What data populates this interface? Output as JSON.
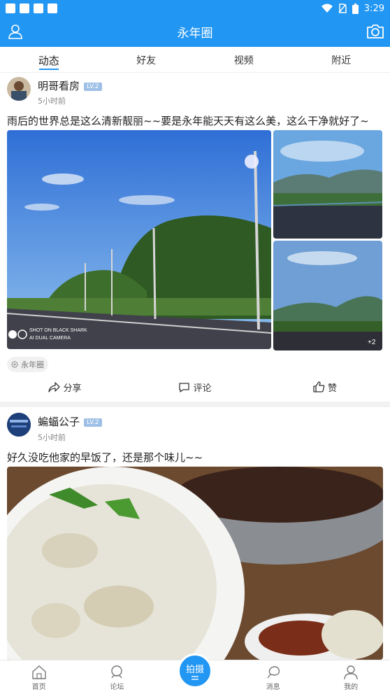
{
  "status_bar": {
    "time": "3:29"
  },
  "app_bar": {
    "title": "永年圈"
  },
  "tabs": [
    "动态",
    "好友",
    "视频",
    "附近"
  ],
  "posts": [
    {
      "author": "明哥看房",
      "level": "LV.2",
      "time": "5小时前",
      "text": "雨后的世界总是这么清新靓丽~~要是永年能天天有这么美，这么干净就好了~",
      "photo_watermark_1": "SHOT ON BLACK SHARK",
      "photo_watermark_2": "AI DUAL CAMERA",
      "more_count": "+2",
      "tag": "永年圈",
      "actions": {
        "share": "分享",
        "comment": "评论",
        "like": "赞"
      }
    },
    {
      "author": "蝙蝠公子",
      "level": "LV.2",
      "time": "5小时前",
      "text": "好久没吃他家的早饭了，还是那个味儿~~"
    }
  ],
  "bottom_nav": {
    "home": "首页",
    "forum": "论坛",
    "shoot": "拍摄",
    "messages": "消息",
    "mine": "我的"
  },
  "colors": {
    "brand": "#2196f3"
  }
}
